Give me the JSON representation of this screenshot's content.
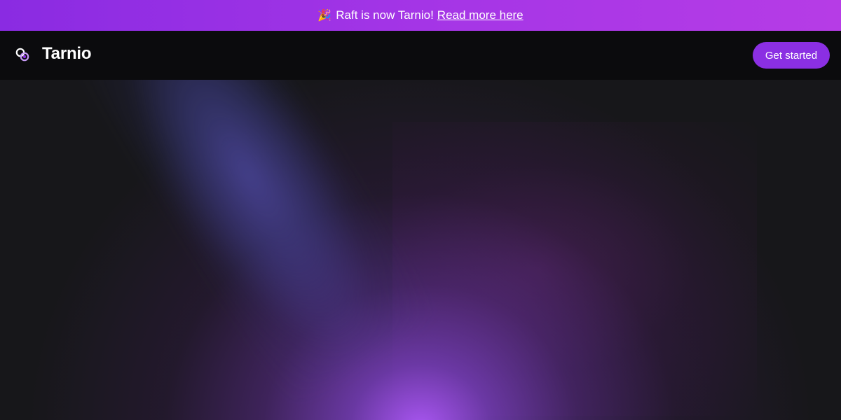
{
  "announcement": {
    "emoji": "🎉",
    "text": "Raft is now Tarnio!",
    "link_label": "Read more here"
  },
  "nav": {
    "logo_icon": "linked-circles-icon",
    "brand": "Tarnio",
    "cta_label": "Get started"
  },
  "colors": {
    "announcement_bg": "#9b31e4",
    "nav_bg": "#0b0b0d",
    "cta_bg": "#8b2fe3",
    "hero_bg": "#17171a",
    "glow": "#b25aff"
  }
}
